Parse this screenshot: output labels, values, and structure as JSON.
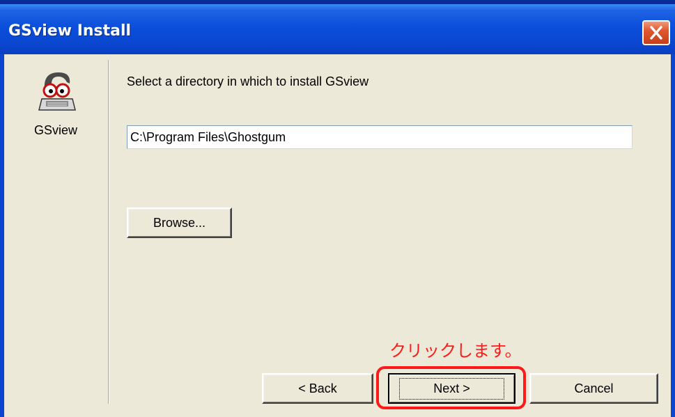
{
  "window": {
    "title": "GSview Install"
  },
  "app": {
    "icon_name": "gsview-ghost-icon",
    "label": "GSview"
  },
  "main": {
    "prompt": "Select a directory in which to install GSview",
    "install_dir_value": "C:\\Program Files\\Ghostgum",
    "browse_label": "Browse..."
  },
  "footer": {
    "back_label": "< Back",
    "next_label": "Next >",
    "cancel_label": "Cancel"
  },
  "annotation": {
    "text": "クリックします。",
    "color": "#ff1a1a"
  },
  "colors": {
    "titlebar": "#0a46cf",
    "dialog_bg": "#ece9d8",
    "close_button": "#e0582f"
  }
}
